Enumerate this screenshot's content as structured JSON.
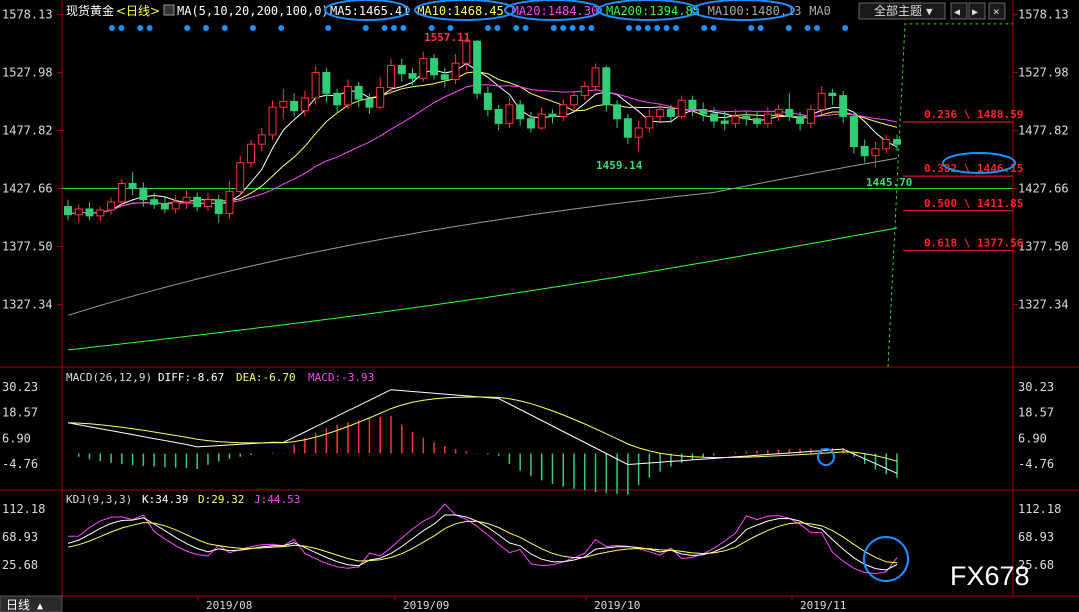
{
  "header": {
    "instrument": "现货黄金",
    "period": "<日线>",
    "ma_params": "MA(5,10,20,200,100,0)",
    "ma_values": [
      {
        "label": "MA5:1465.41",
        "color": "#ffffff"
      },
      {
        "label": "MA10:1468.45",
        "color": "#ffff55"
      },
      {
        "label": "MA20:1484.30",
        "color": "#ff44ff"
      },
      {
        "label": "MA200:1394.85",
        "color": "#33ff33"
      },
      {
        "label": "MA100:1480.13",
        "color": "#aaaaaa"
      },
      {
        "label": "MA0",
        "color": "#aaaaaa"
      }
    ],
    "theme_button": "全部主题",
    "theme_arrow": "▼",
    "buttons": [
      "◀",
      "▶",
      "×"
    ]
  },
  "colors": {
    "up": "#ff3333",
    "down": "#33cc77",
    "ma5": "#ffffff",
    "ma10": "#ffff55",
    "ma20": "#ff44ff",
    "ma100": "#9a9a9a",
    "ma200": "#33ff33",
    "fib": "#ff2222",
    "axis": "#aa0000",
    "annotation": "#1e90ff"
  },
  "price_axis": [
    "1578.13",
    "1527.98",
    "1477.82",
    "1427.66",
    "1377.50",
    "1327.34"
  ],
  "macd_axis": [
    "30.23",
    "18.57",
    "6.90",
    "-4.76"
  ],
  "kdj_axis": [
    "112.18",
    "68.93",
    "25.68"
  ],
  "x_axis": [
    "2019/08",
    "2019/09",
    "2019/10",
    "2019/11"
  ],
  "annotations": {
    "high": "1557.11",
    "low1": "1459.14",
    "low2": "1445.70"
  },
  "fib_levels": [
    {
      "label": "0.236 \\ 1488.59",
      "price": 1488.59
    },
    {
      "label": "0.382 \\ 1446.15",
      "price": 1446.15
    },
    {
      "label": "0.500 \\ 1411.85",
      "price": 1411.85
    },
    {
      "label": "0.618 \\ 1377.56",
      "price": 1377.56
    }
  ],
  "macd": {
    "title": "MACD(26,12,9)",
    "diff": "DIFF:-8.67",
    "dea": "DEA:-6.70",
    "macd": "MACD:-3.93"
  },
  "kdj": {
    "title": "KDJ(9,3,3)",
    "k": "K:34.39",
    "d": "D:29.32",
    "j": "J:44.53"
  },
  "footer": {
    "tab": "日线",
    "tab_arrow": "▲"
  },
  "watermark": "FX678",
  "chart_data": [
    {
      "type": "candlestick",
      "title": "现货黄金<日线>",
      "ylim": [
        1290,
        1590
      ],
      "x_range": [
        "2019-07-24",
        "2019-11-15"
      ],
      "notable_prices": {
        "high": 1557.11,
        "low_oct": 1459.14,
        "low_nov": 1445.7,
        "support": 1427.66
      },
      "series": [
        {
          "name": "MA5",
          "last": 1465.41
        },
        {
          "name": "MA10",
          "last": 1468.45
        },
        {
          "name": "MA20",
          "last": 1484.3
        },
        {
          "name": "MA200",
          "last": 1394.85
        },
        {
          "name": "MA100",
          "last": 1480.13
        }
      ]
    },
    {
      "type": "bar",
      "title": "MACD(26,12,9)",
      "ylim": [
        -15,
        35
      ],
      "series": [
        {
          "name": "DIFF",
          "last": -8.67
        },
        {
          "name": "DEA",
          "last": -6.7
        },
        {
          "name": "MACD",
          "last": -3.93
        }
      ]
    },
    {
      "type": "line",
      "title": "KDJ(9,3,3)",
      "ylim": [
        0,
        120
      ],
      "series": [
        {
          "name": "K",
          "last": 34.39
        },
        {
          "name": "D",
          "last": 29.32
        },
        {
          "name": "J",
          "last": 44.53
        }
      ]
    }
  ]
}
